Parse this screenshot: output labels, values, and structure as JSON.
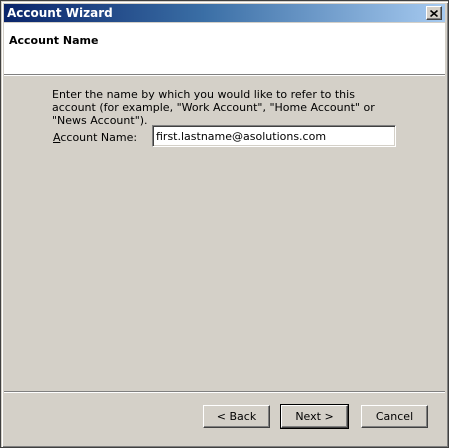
{
  "window": {
    "title": "Account Wizard",
    "close_icon": "close-icon"
  },
  "header": {
    "title": "Account Name"
  },
  "content": {
    "description": "Enter the name by which you would like to refer to this account (for example, \"Work Account\", \"Home Account\" or \"News Account\").",
    "field_label_accesskey": "A",
    "field_label_rest": "ccount Name:",
    "field_value": "first.lastname@asolutions.com"
  },
  "buttons": {
    "back": "< Back",
    "next": "Next >",
    "cancel": "Cancel"
  },
  "colors": {
    "titlebar_start": "#0a246a",
    "titlebar_end": "#a6caf0",
    "face": "#d4d0c8",
    "header_bg": "#ffffff"
  }
}
